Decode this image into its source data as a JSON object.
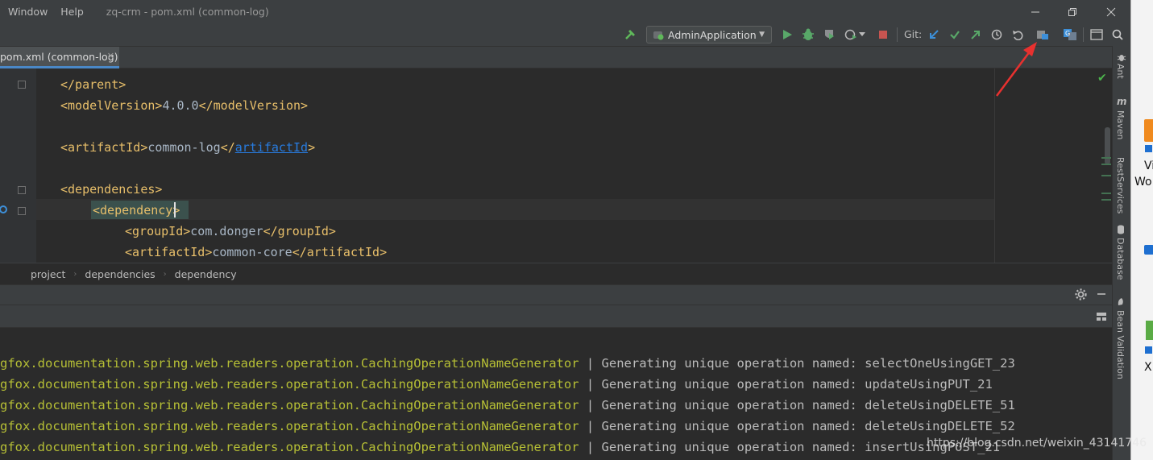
{
  "menu": {
    "window_label": "Window",
    "help_label": "Help",
    "window_title": "zq-crm - pom.xml (common-log)"
  },
  "toolbar": {
    "run_config": "AdminApplication",
    "git_label": "Git:"
  },
  "editor": {
    "tab_label": "pom.xml (common-log)",
    "lines": {
      "l1_close": "</parent>",
      "l2_open": "<modelVersion>",
      "l2_value": "4.0.0",
      "l2_close": "</modelVersion>",
      "l3_open": "<artifactId>",
      "l3_value": "common-log",
      "l3_close_a": "</",
      "l3_link": "artifactId",
      "l3_close_b": ">",
      "l4": "<dependencies>",
      "l5": "<dependency>",
      "l6_open": "<groupId>",
      "l6_value": "com.donger",
      "l6_close": "</groupId>",
      "l7_open": "<artifactId>",
      "l7_value": "common-core",
      "l7_close": "</artifactId>"
    }
  },
  "breadcrumbs": [
    "project",
    "dependencies",
    "dependency"
  ],
  "console": {
    "lines": [
      {
        "cls": "gfox.documentation.spring.web.readers.operation.CachingOperationNameGenerator",
        "msg": " | Generating unique operation named: selectOneUsingGET_23"
      },
      {
        "cls": "gfox.documentation.spring.web.readers.operation.CachingOperationNameGenerator",
        "msg": " | Generating unique operation named: updateUsingPUT_21"
      },
      {
        "cls": "gfox.documentation.spring.web.readers.operation.CachingOperationNameGenerator",
        "msg": " | Generating unique operation named: deleteUsingDELETE_51"
      },
      {
        "cls": "gfox.documentation.spring.web.readers.operation.CachingOperationNameGenerator",
        "msg": " | Generating unique operation named: deleteUsingDELETE_52"
      },
      {
        "cls": "gfox.documentation.spring.web.readers.operation.CachingOperationNameGenerator",
        "msg": " | Generating unique operation named: insertUsingPOST_21"
      }
    ]
  },
  "right_tools": {
    "ant": "Ant",
    "maven": "Maven",
    "rest": "RestServices",
    "database": "Database",
    "bean": "Bean Validation"
  },
  "desktop": {
    "text_1": "Vi",
    "text_2": "Wo",
    "text_3": "X"
  },
  "watermark": "https://blog.csdn.net/weixin_43141746",
  "colors": {
    "background": "#2b2b2b",
    "chrome": "#3c3f41",
    "xml_tag": "#e8bf6a",
    "xml_text": "#a9b7c6",
    "log_class": "#b6bf35",
    "link": "#287bde",
    "annotation_arrow": "#e8312f"
  }
}
